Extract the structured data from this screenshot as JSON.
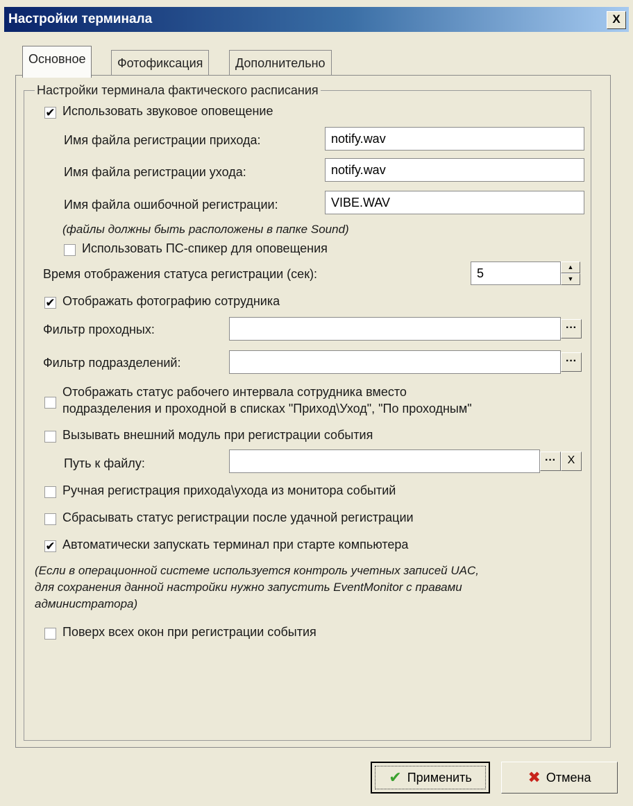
{
  "window": {
    "title": "Настройки терминала",
    "close_glyph": "X"
  },
  "tabs": [
    {
      "label": "Основное",
      "active": true
    },
    {
      "label": "Фотофиксация",
      "active": false
    },
    {
      "label": "Дополнительно",
      "active": false
    }
  ],
  "group": {
    "title": "Настройки терминала фактического расписания"
  },
  "sound": {
    "checkbox_label": "Использовать звуковое оповещение",
    "checked": true,
    "arrive_label": "Имя файла регистрации прихода:",
    "arrive_value": "notify.wav",
    "leave_label": "Имя файла регистрации ухода:",
    "leave_value": "notify.wav",
    "error_label": "Имя файла ошибочной регистрации:",
    "error_value": "VIBE.WAV",
    "note": "(файлы должны быть расположены в папке Sound)",
    "pc_speaker_label": "Использовать ПС-спикер для оповещения",
    "pc_speaker_checked": false
  },
  "status_time": {
    "label": "Время отображения статуса регистрации (сек):",
    "value": "5"
  },
  "photo": {
    "label": "Отображать фотографию сотрудника",
    "checked": true
  },
  "filters": {
    "passes_label": "Фильтр проходных:",
    "passes_value": "",
    "departments_label": "Фильтр подразделений:",
    "departments_value": "",
    "browse_glyph": "···"
  },
  "work_interval": {
    "line1": "Отображать статус рабочего интервала сотрудника вместо",
    "line2": "подразделения и проходной в списках \"Приход\\Уход\", \"По проходным\"",
    "checked": false
  },
  "external_module": {
    "label": "Вызывать внешний модуль при регистрации события",
    "checked": false,
    "path_label": "Путь к файлу:",
    "path_value": "",
    "clear_glyph": "X"
  },
  "manual": {
    "label": "Ручная регистрация прихода\\ухода из монитора событий",
    "checked": false
  },
  "reset": {
    "label": "Сбрасывать статус регистрации после удачной регистрации",
    "checked": false
  },
  "autostart": {
    "label": "Автоматически запускать терминал при старте компьютера",
    "checked": true
  },
  "uac_note": {
    "line1": "(Если в операционной системе используется контроль учетных записей UAC,",
    "line2": "для сохранения данной настройки нужно запустить EventMonitor с правами",
    "line3": "администратора)"
  },
  "on_top": {
    "label": "Поверх всех окон при регистрации события",
    "checked": false
  },
  "buttons": {
    "apply_label": "Применить",
    "cancel_label": "Отмена"
  },
  "glyphs": {
    "check": "✔"
  },
  "colors": {
    "title_start": "#0a246a",
    "apply_icon": "#3aa12e",
    "cancel_icon": "#c8231b"
  }
}
